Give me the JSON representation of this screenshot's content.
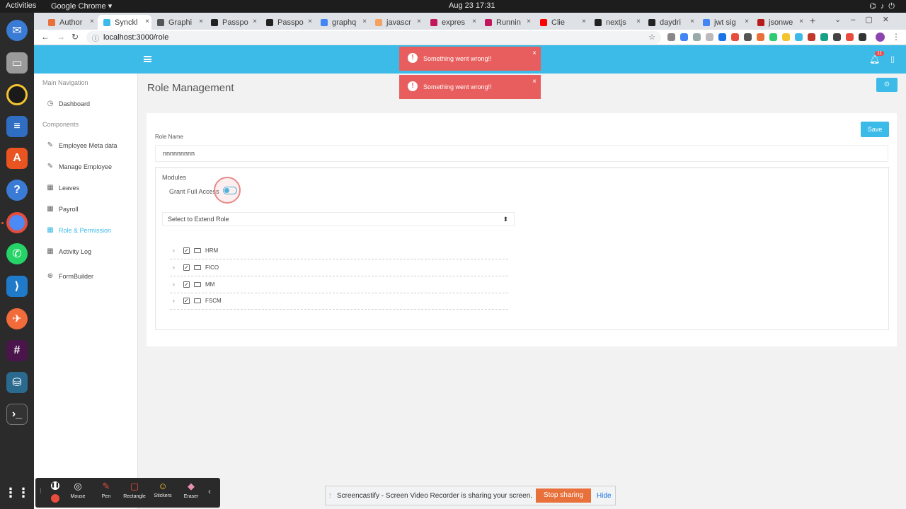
{
  "os": {
    "activities": "Activities",
    "app_name": "Google Chrome ▾",
    "clock": "Aug 23  17:31",
    "tray_icons": [
      "network-icon",
      "volume-icon",
      "power-icon"
    ]
  },
  "browser": {
    "tabs": [
      {
        "label": "Author",
        "color": "#e8703a"
      },
      {
        "label": "Synckl",
        "color": "#3dbbe8",
        "active": true
      },
      {
        "label": "Graphi",
        "color": "#555555"
      },
      {
        "label": "Passpo",
        "color": "#222222"
      },
      {
        "label": "Passpo",
        "color": "#222222"
      },
      {
        "label": "graphq",
        "color": "#4285f4"
      },
      {
        "label": "javascr",
        "color": "#f4a261"
      },
      {
        "label": "expres",
        "color": "#c2185b"
      },
      {
        "label": "Runnin",
        "color": "#c2185b"
      },
      {
        "label": "Clie",
        "color": "#ff0000"
      },
      {
        "label": "nextjs",
        "color": "#222222"
      },
      {
        "label": "daydri",
        "color": "#222222"
      },
      {
        "label": "jwt sig",
        "color": "#4285f4"
      },
      {
        "label": "jsonwe",
        "color": "#b71c1c"
      }
    ],
    "url": "localhost:3000/role"
  },
  "header": {
    "notification_count": "11"
  },
  "sidebar": {
    "sections": [
      {
        "label": "Main Navigation"
      },
      {
        "label": "Components"
      }
    ],
    "items": [
      {
        "label": "Dashboard",
        "icon": "dashboard-icon",
        "glyph": "◷"
      },
      {
        "label": "Employee Meta data",
        "icon": "pen-icon",
        "glyph": "✎"
      },
      {
        "label": "Manage Employee",
        "icon": "edit-icon",
        "glyph": "✎"
      },
      {
        "label": "Leaves",
        "icon": "grid-icon",
        "glyph": "▦"
      },
      {
        "label": "Payroll",
        "icon": "grid-icon",
        "glyph": "▦"
      },
      {
        "label": "Role & Permission",
        "icon": "grid-icon",
        "glyph": "▦",
        "active": true
      },
      {
        "label": "Activity Log",
        "icon": "grid-icon",
        "glyph": "▦"
      },
      {
        "label": "FormBuilder",
        "icon": "plus-circle-icon",
        "glyph": "⊕"
      }
    ]
  },
  "main": {
    "title": "Role Management",
    "save_label": "Save",
    "role_name_label": "Role Name",
    "role_name_value": "nnnnnnnnn",
    "modules_label": "Modules",
    "grant_full_access_label": "Grant Full Access",
    "grant_full_access": true,
    "extend_role_placeholder": "Select to Extend Role",
    "modules": [
      {
        "name": "HRM",
        "checked": true
      },
      {
        "name": "FICO",
        "checked": true
      },
      {
        "name": "MM",
        "checked": true
      },
      {
        "name": "FSCM",
        "checked": true
      }
    ]
  },
  "toasts": [
    {
      "message": "Something went wrong!!"
    },
    {
      "message": "Something went wrong!!"
    }
  ],
  "screencastify": {
    "tools": [
      {
        "label": "Mouse",
        "glyph": "◎"
      },
      {
        "label": "Pen",
        "glyph": "✎"
      },
      {
        "label": "Rectangle",
        "glyph": "▢"
      },
      {
        "label": "Stickers",
        "glyph": "☺"
      },
      {
        "label": "Eraser",
        "glyph": "◆"
      }
    ],
    "share_message": "Screencastify - Screen Video Recorder is sharing your screen.",
    "stop_label": "Stop sharing",
    "hide_label": "Hide"
  }
}
